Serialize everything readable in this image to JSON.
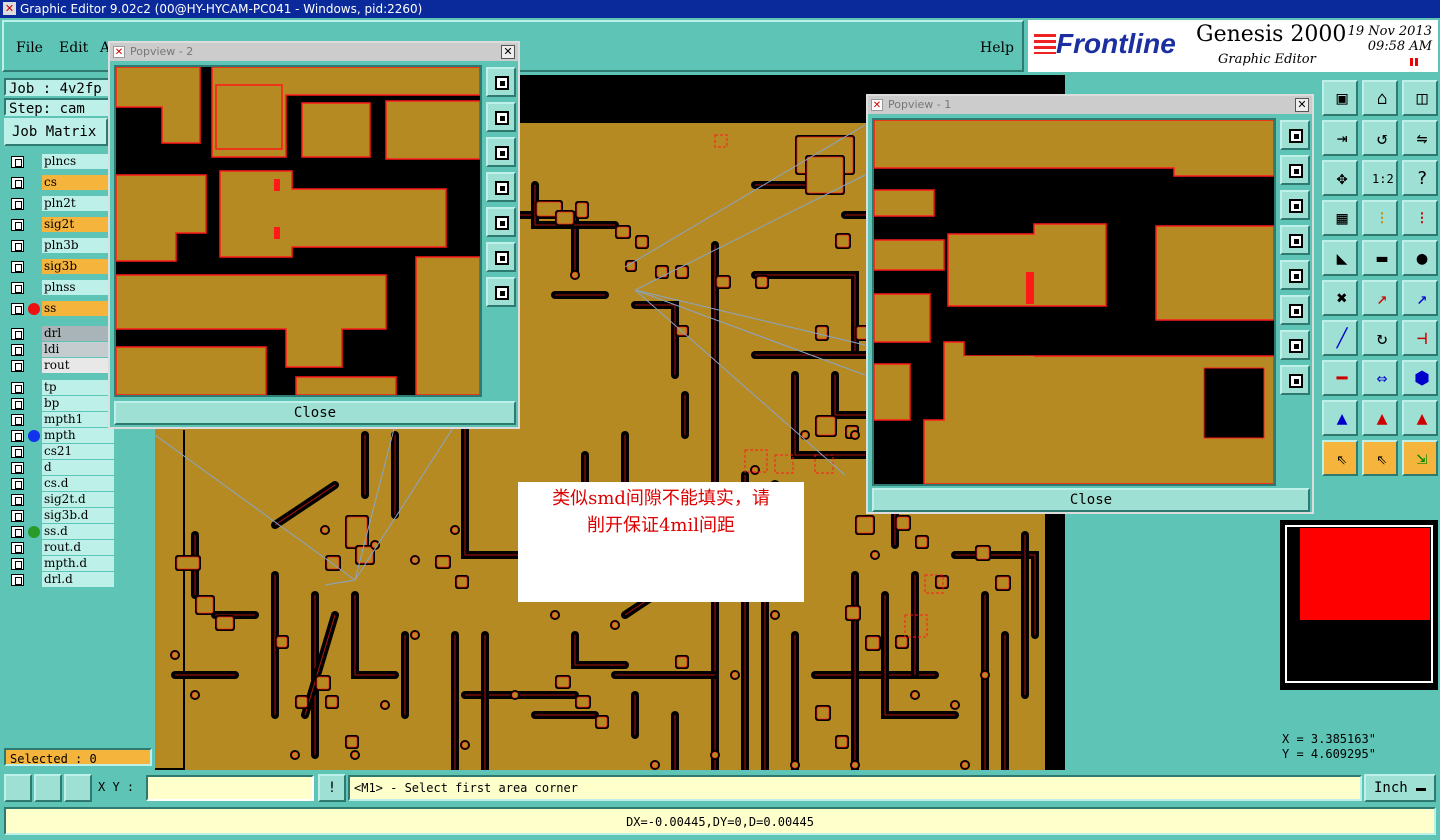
{
  "window": {
    "title": "Graphic Editor 9.02c2 (00@HY-HYCAM-PC041 - Windows, pid:2260)"
  },
  "menu": {
    "file": "File",
    "edit": "Edit",
    "action": "A",
    "help": "Help"
  },
  "brand": {
    "logo": "Frontline",
    "product": "Genesis 2000",
    "subtitle": "Graphic Editor",
    "date": "19 Nov 2013",
    "time": "09:58 AM"
  },
  "job": {
    "job_line": "Job : 4v2fp",
    "step_line": "Step: cam",
    "matrix_label": "Job Matrix"
  },
  "layers": [
    {
      "name": "plncs",
      "bg": "#bdf0e8",
      "dot": ""
    },
    {
      "name": "cs",
      "bg": "#f5b43c",
      "dot": ""
    },
    {
      "name": "pln2t",
      "bg": "#bdf0e8",
      "dot": ""
    },
    {
      "name": "sig2t",
      "bg": "#f5b43c",
      "dot": ""
    },
    {
      "name": "pln3b",
      "bg": "#bdf0e8",
      "dot": ""
    },
    {
      "name": "sig3b",
      "bg": "#f5b43c",
      "dot": ""
    },
    {
      "name": "plnss",
      "bg": "#bdf0e8",
      "dot": ""
    },
    {
      "name": "ss",
      "bg": "#f5b43c",
      "dot": "#e11"
    },
    {
      "name": "drl",
      "bg": "#a8b4b8",
      "dot": ""
    },
    {
      "name": "ldi",
      "bg": "#c4ccd0",
      "dot": ""
    },
    {
      "name": "rout",
      "bg": "#e8e8e8",
      "dot": ""
    },
    {
      "name": "tp",
      "bg": "#bdf0e8",
      "dot": ""
    },
    {
      "name": "bp",
      "bg": "#bdf0e8",
      "dot": ""
    },
    {
      "name": "mpth1",
      "bg": "#bdf0e8",
      "dot": ""
    },
    {
      "name": "mpth",
      "bg": "#bdf0e8",
      "dot": "#1133ee"
    },
    {
      "name": "cs21",
      "bg": "#bdf0e8",
      "dot": ""
    },
    {
      "name": "d",
      "bg": "#bdf0e8",
      "dot": ""
    },
    {
      "name": "cs.d",
      "bg": "#bdf0e8",
      "dot": ""
    },
    {
      "name": "sig2t.d",
      "bg": "#bdf0e8",
      "dot": ""
    },
    {
      "name": "sig3b.d",
      "bg": "#bdf0e8",
      "dot": ""
    },
    {
      "name": "ss.d",
      "bg": "#bdf0e8",
      "dot": "#2a9a2a"
    },
    {
      "name": "rout.d",
      "bg": "#bdf0e8",
      "dot": ""
    },
    {
      "name": "mpth.d",
      "bg": "#bdf0e8",
      "dot": ""
    },
    {
      "name": "drl.d",
      "bg": "#bdf0e8",
      "dot": ""
    }
  ],
  "selected": "Selected : 0",
  "popview2": {
    "title": "Popview - 2",
    "close": "Close"
  },
  "popview1": {
    "title": "Popview - 1",
    "close": "Close"
  },
  "annotation": {
    "line1": "类似smd间隙不能填实，请",
    "line2": "削开保证4mil间距"
  },
  "coords": {
    "x": "X = 3.385163\"",
    "y": "Y = 4.609295\""
  },
  "status": {
    "xy_label": "X Y :",
    "xy_value": "",
    "prompt": "<M1> - Select first area corner",
    "unit": "Inch",
    "dx": "DX=-0.00445,DY=0,D=0.00445"
  },
  "colors": {
    "copper": "#b58a22",
    "outline": "#ff1a1a",
    "panel": "#5ec4b6",
    "title": "#0a2a9c"
  },
  "tool_icons": [
    "home-icon",
    "window-icon",
    "layout-icon",
    "export-icon",
    "undo-icon",
    "route-icon",
    "pan-icon",
    "scale-icon",
    "help-icon",
    "grid-icon",
    "traffic-light-icon",
    "traffic-light-red-icon",
    "profile-icon",
    "ruler-icon",
    "pad-icon",
    "snap-icon",
    "measure-icon",
    "measure-blue-icon",
    "line-icon",
    "arc-icon",
    "ff-icon",
    "cut-icon",
    "dimension-icon",
    "shapes-icon",
    "outline-icon",
    "outline-red-icon",
    "outline-green-icon",
    "select-icon",
    "pointer-icon",
    "net-icon"
  ]
}
